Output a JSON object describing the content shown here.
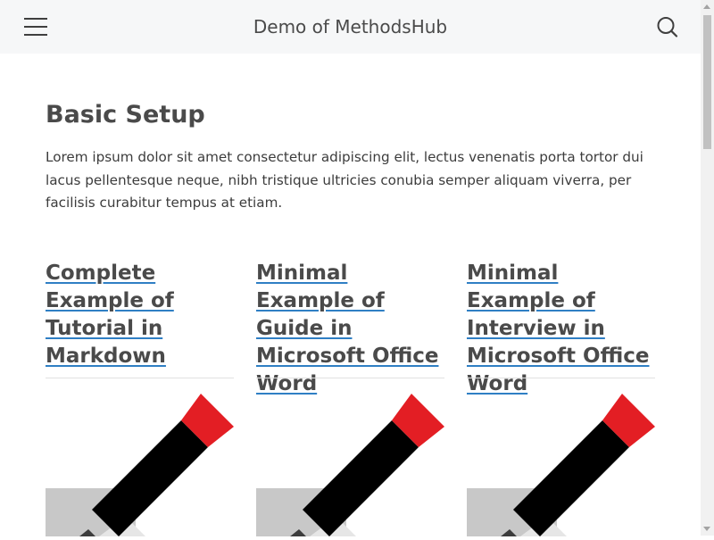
{
  "header": {
    "site_title": "Demo of MethodsHub",
    "menu_icon": "hamburger-menu-icon",
    "search_icon": "search-icon",
    "background": "#f6f7f8"
  },
  "main": {
    "heading": "Basic Setup",
    "description": "Lorem ipsum dolor sit amet consectetur adipiscing elit, lectus venenatis porta tortor dui lacus pellentesque neque, nibh tristique ultricies conubia semper aliquam viverra, per facilisis curabitur tempus at etiam.",
    "cards": [
      {
        "title": "Complete Example of Tutorial in Markdown",
        "thumbnail_icon": "marker-pen-icon"
      },
      {
        "title": "Minimal Example of Guide in Microsoft Office Word",
        "thumbnail_icon": "marker-pen-icon"
      },
      {
        "title": "Minimal Example of Interview in Microsoft Office Word",
        "thumbnail_icon": "marker-pen-icon"
      }
    ]
  },
  "colors": {
    "link_underline": "#2f7fc4",
    "marker_cap": "#e31e24",
    "marker_body": "#000000",
    "thumb_background": "#c8c8c8"
  }
}
